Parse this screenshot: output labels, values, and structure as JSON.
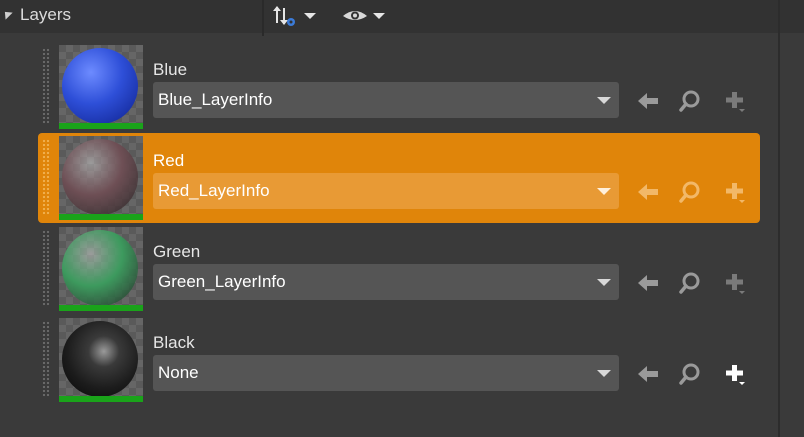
{
  "panel": {
    "title": "Layers",
    "sort_icon": "sort-filter-icon",
    "visibility_icon": "eye-icon"
  },
  "layers": [
    {
      "name": "Blue",
      "layer_info": "Blue_LayerInfo",
      "selected": false,
      "preview_color": "#2e4fd8",
      "add_enabled": false
    },
    {
      "name": "Red",
      "layer_info": "Red_LayerInfo",
      "selected": true,
      "preview_color": "#6e4f55",
      "add_enabled": false
    },
    {
      "name": "Green",
      "layer_info": "Green_LayerInfo",
      "selected": false,
      "preview_color": "#3d9a5e",
      "add_enabled": false
    },
    {
      "name": "Black",
      "layer_info": "None",
      "selected": false,
      "preview_color": "#1c1c1c",
      "add_enabled": true
    }
  ],
  "colors": {
    "selection": "#e0850a",
    "layer_bar": "#1aa31a"
  }
}
